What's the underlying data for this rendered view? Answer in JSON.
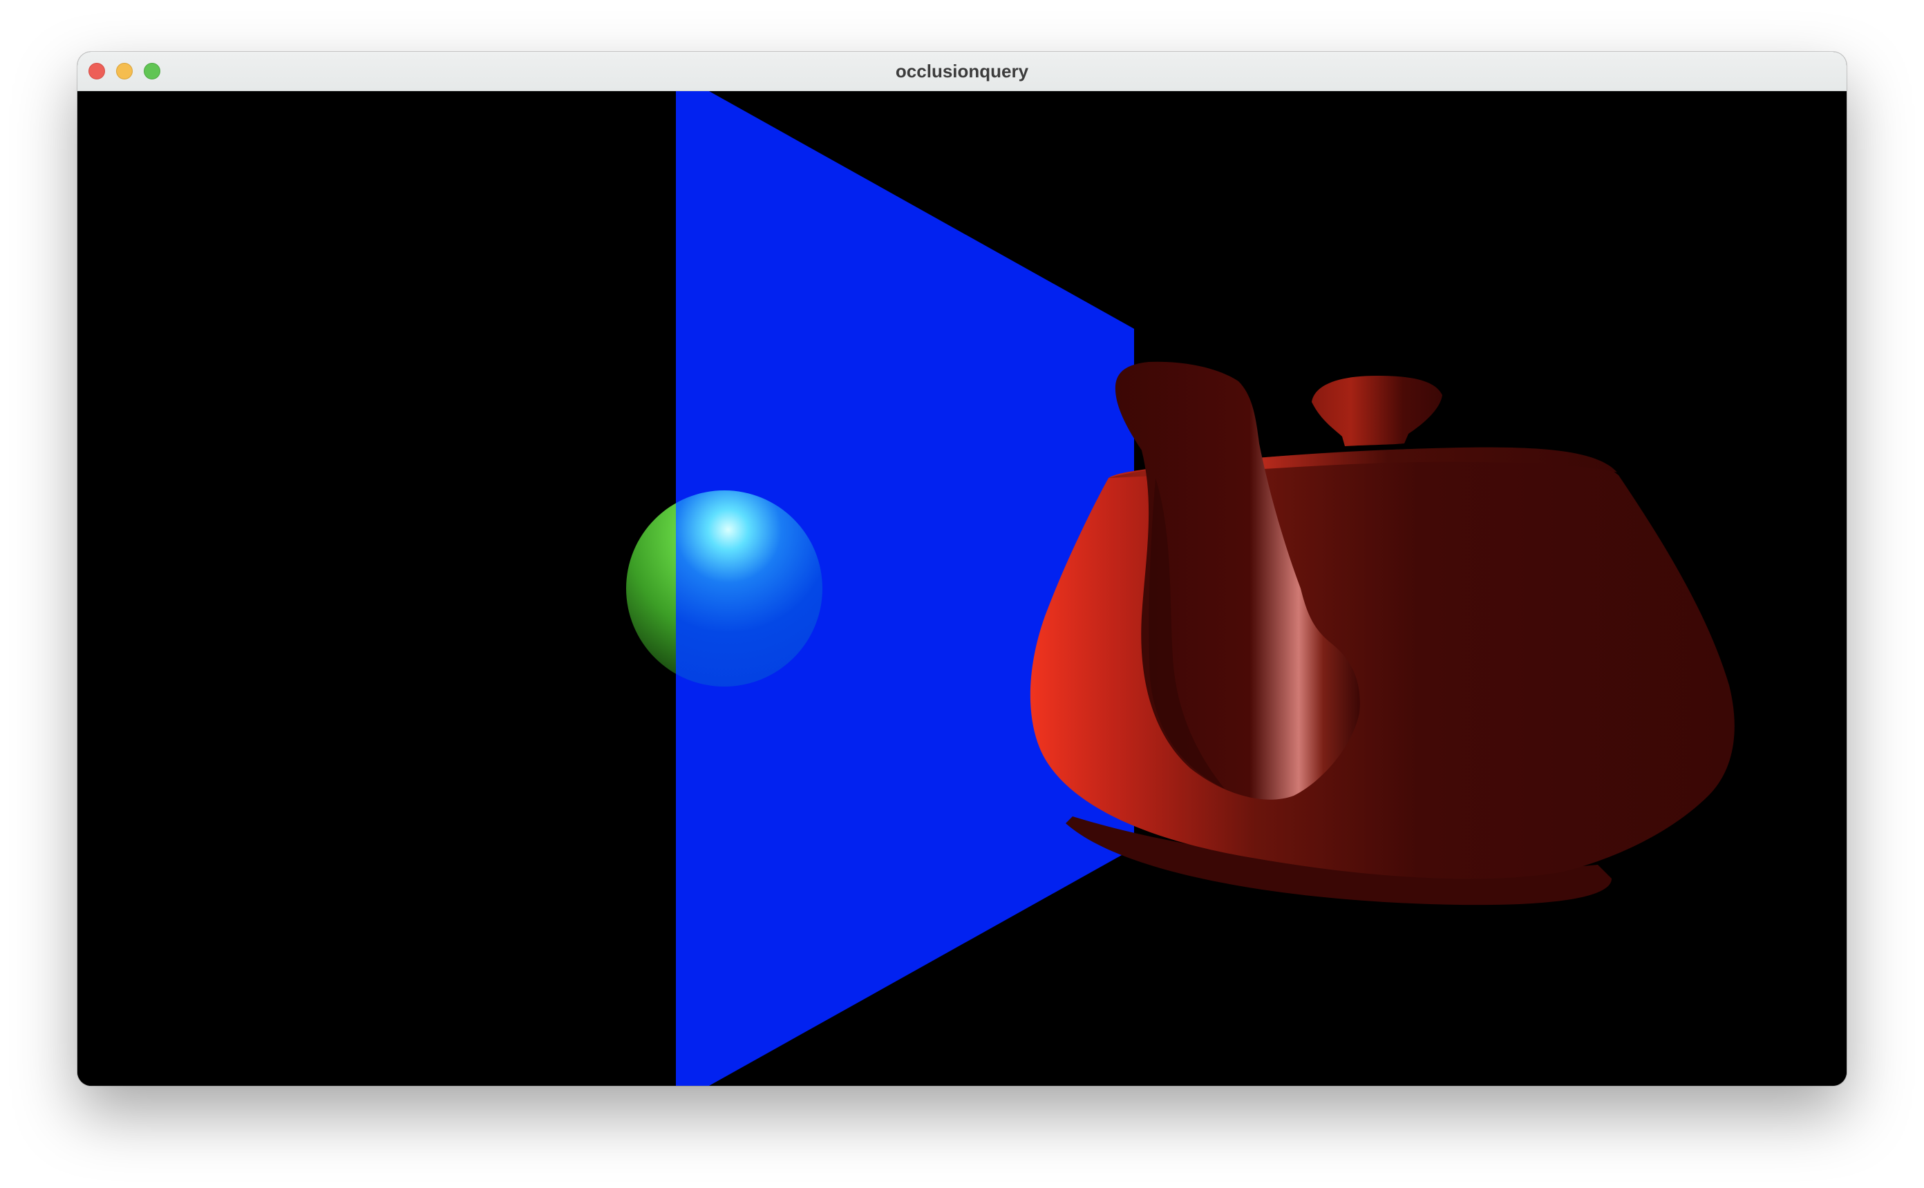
{
  "window": {
    "title": "occlusionquery",
    "controls": {
      "close": "close-icon",
      "minimize": "minimize-icon",
      "zoom": "zoom-icon"
    }
  },
  "scene": {
    "background_color": "#000000",
    "objects": [
      {
        "name": "blue-occluder-plane",
        "color": "#0222f0"
      },
      {
        "name": "green-sphere",
        "color": "#55cc33",
        "occluded_color": "#0445e6"
      },
      {
        "name": "red-teapot",
        "color": "#e03020"
      }
    ]
  }
}
